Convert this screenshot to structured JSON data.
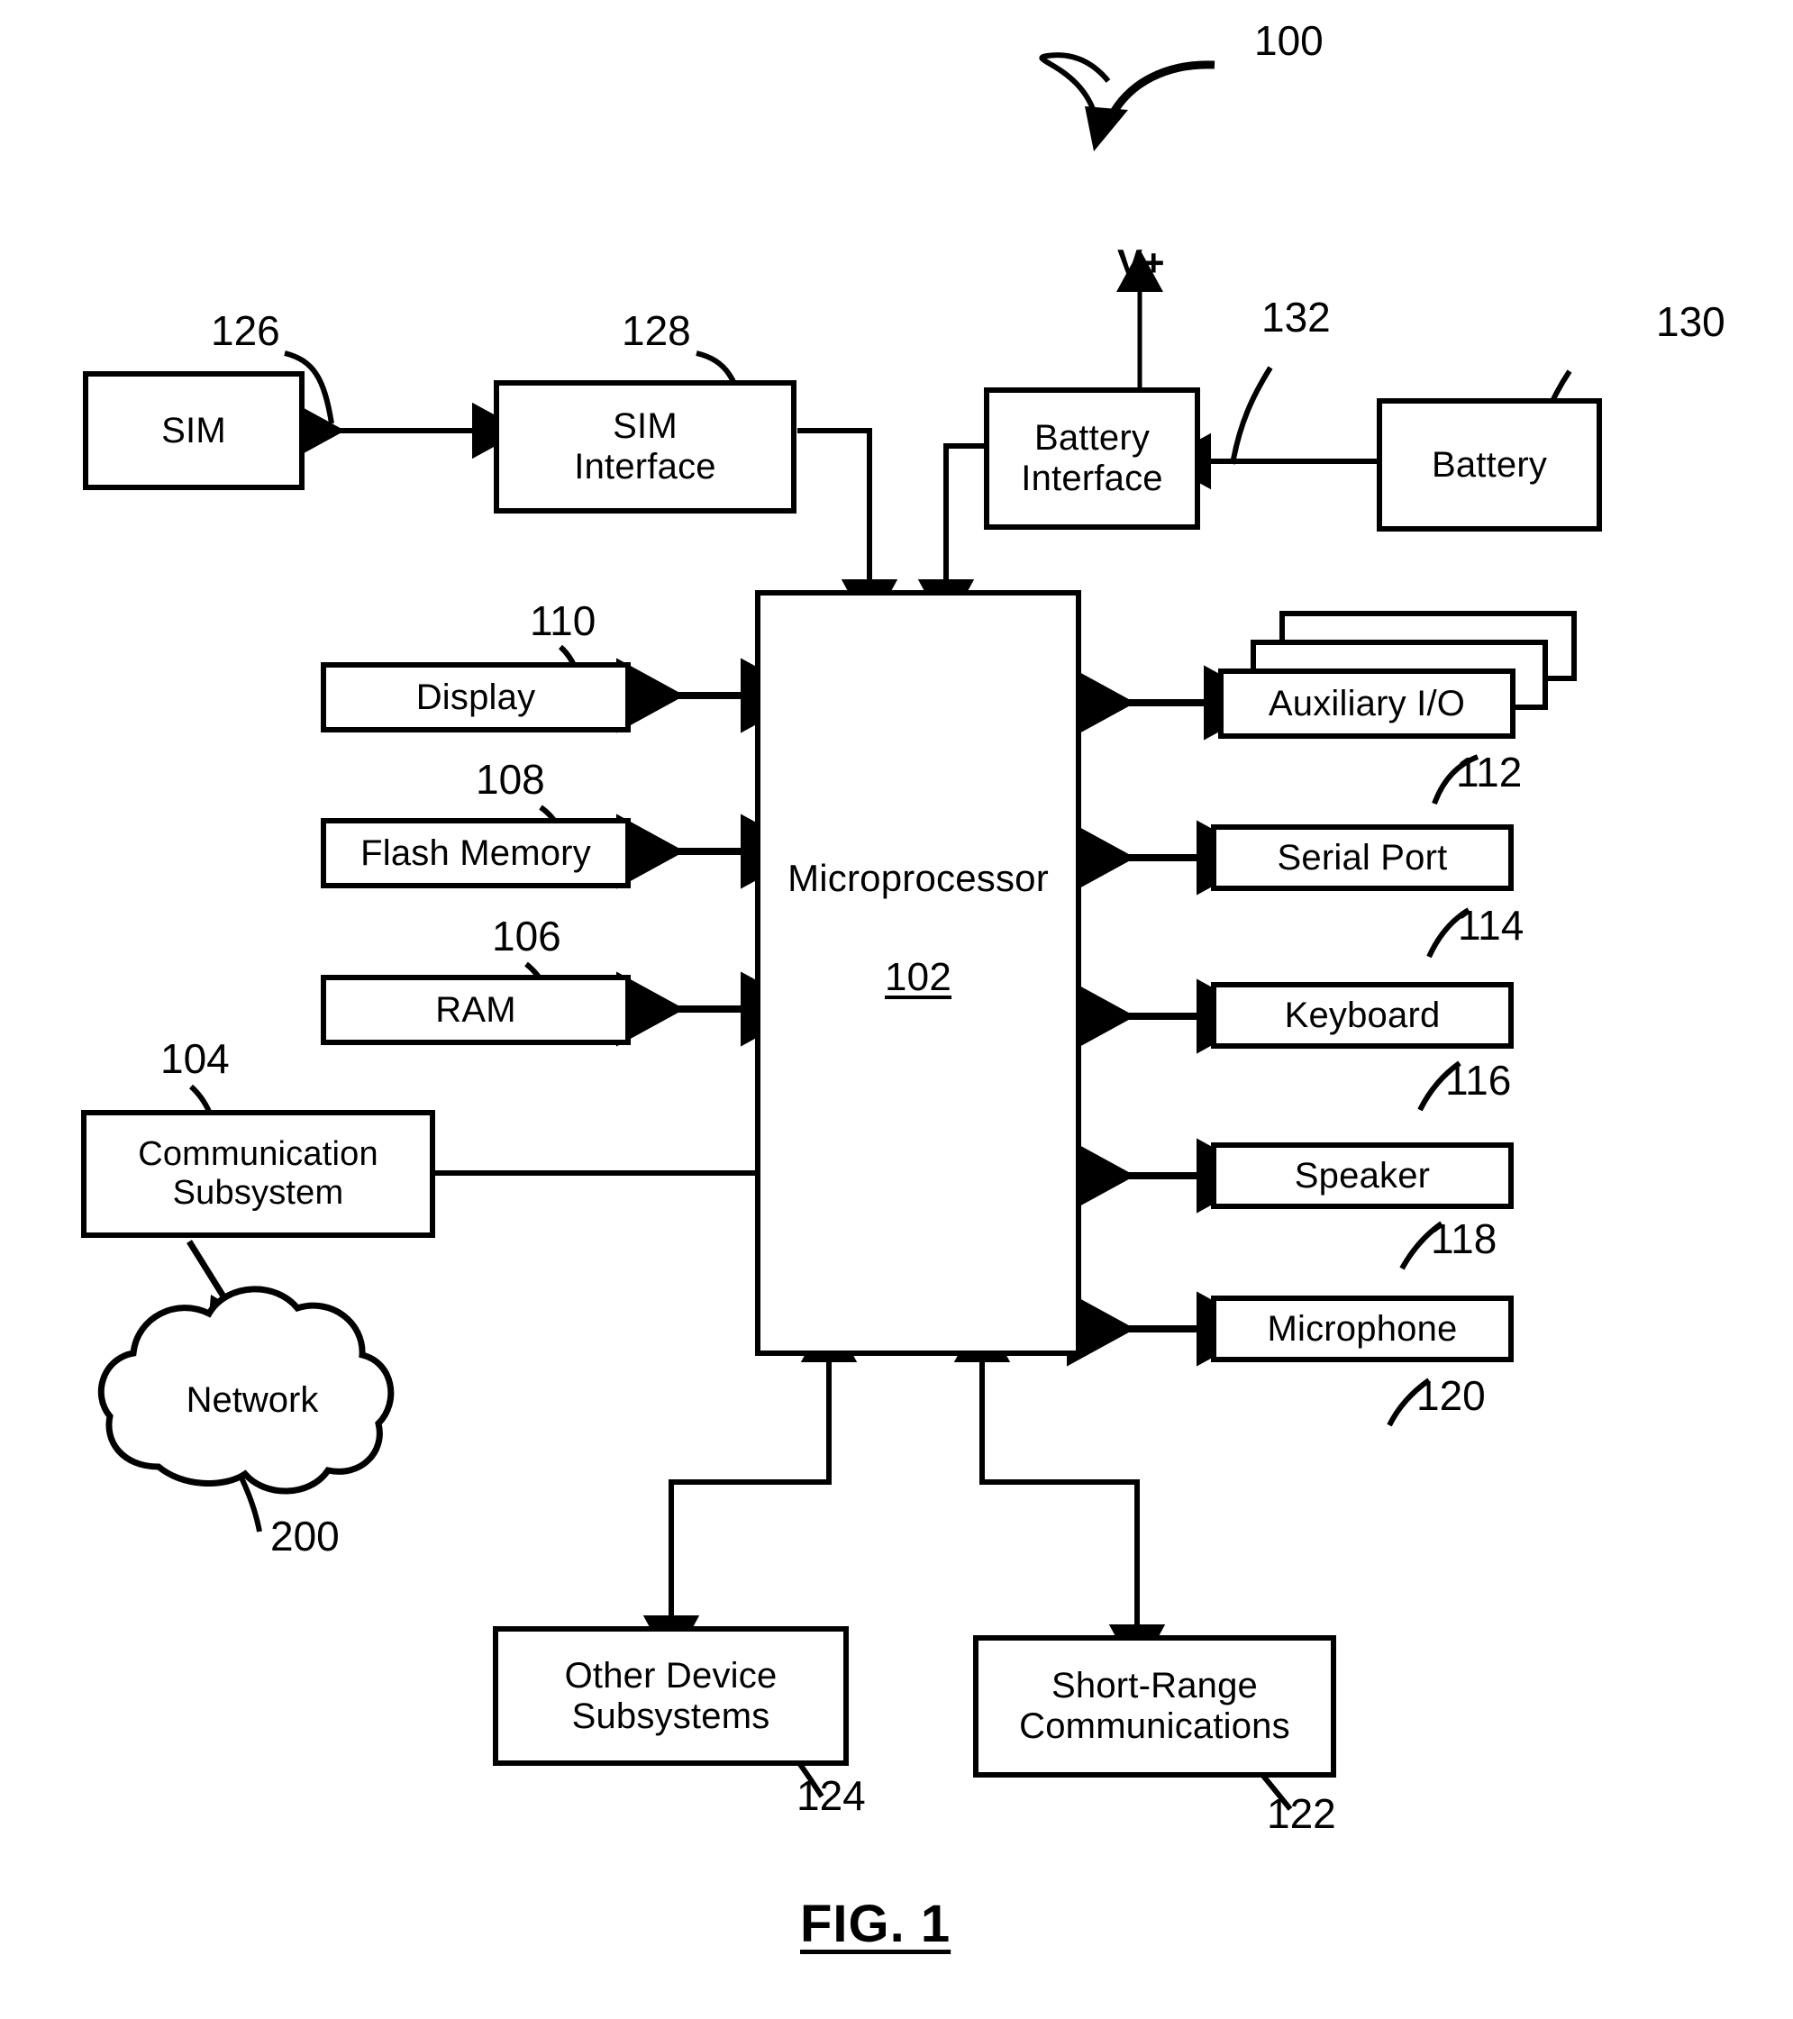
{
  "figure": {
    "caption": "FIG. 1",
    "top_ref": "100",
    "power_label": "V+"
  },
  "blocks": {
    "sim": {
      "label": "SIM",
      "ref": "126"
    },
    "sim_interface": {
      "label": "SIM\nInterface",
      "ref": "128"
    },
    "battery_interface": {
      "label": "Battery\nInterface",
      "ref": "132"
    },
    "battery": {
      "label": "Battery",
      "ref": "130"
    },
    "microprocessor": {
      "label": "Microprocessor",
      "ref": "102"
    },
    "display": {
      "label": "Display",
      "ref": "110"
    },
    "flash_memory": {
      "label": "Flash Memory",
      "ref": "108"
    },
    "ram": {
      "label": "RAM",
      "ref": "106"
    },
    "communication_subsystem": {
      "label": "Communication\nSubsystem",
      "ref": "104"
    },
    "network": {
      "label": "Network",
      "ref": "200"
    },
    "auxiliary_io": {
      "label": "Auxiliary I/O",
      "ref": "112"
    },
    "serial_port": {
      "label": "Serial Port",
      "ref": "114"
    },
    "keyboard": {
      "label": "Keyboard",
      "ref": "116"
    },
    "speaker": {
      "label": "Speaker",
      "ref": "118"
    },
    "microphone": {
      "label": "Microphone",
      "ref": "120"
    },
    "other_device_subsystems": {
      "label": "Other Device\nSubsystems",
      "ref": "124"
    },
    "short_range_communications": {
      "label": "Short-Range\nCommunications",
      "ref": "122"
    }
  },
  "colors": {
    "ink": "#000000",
    "paper": "#ffffff"
  }
}
